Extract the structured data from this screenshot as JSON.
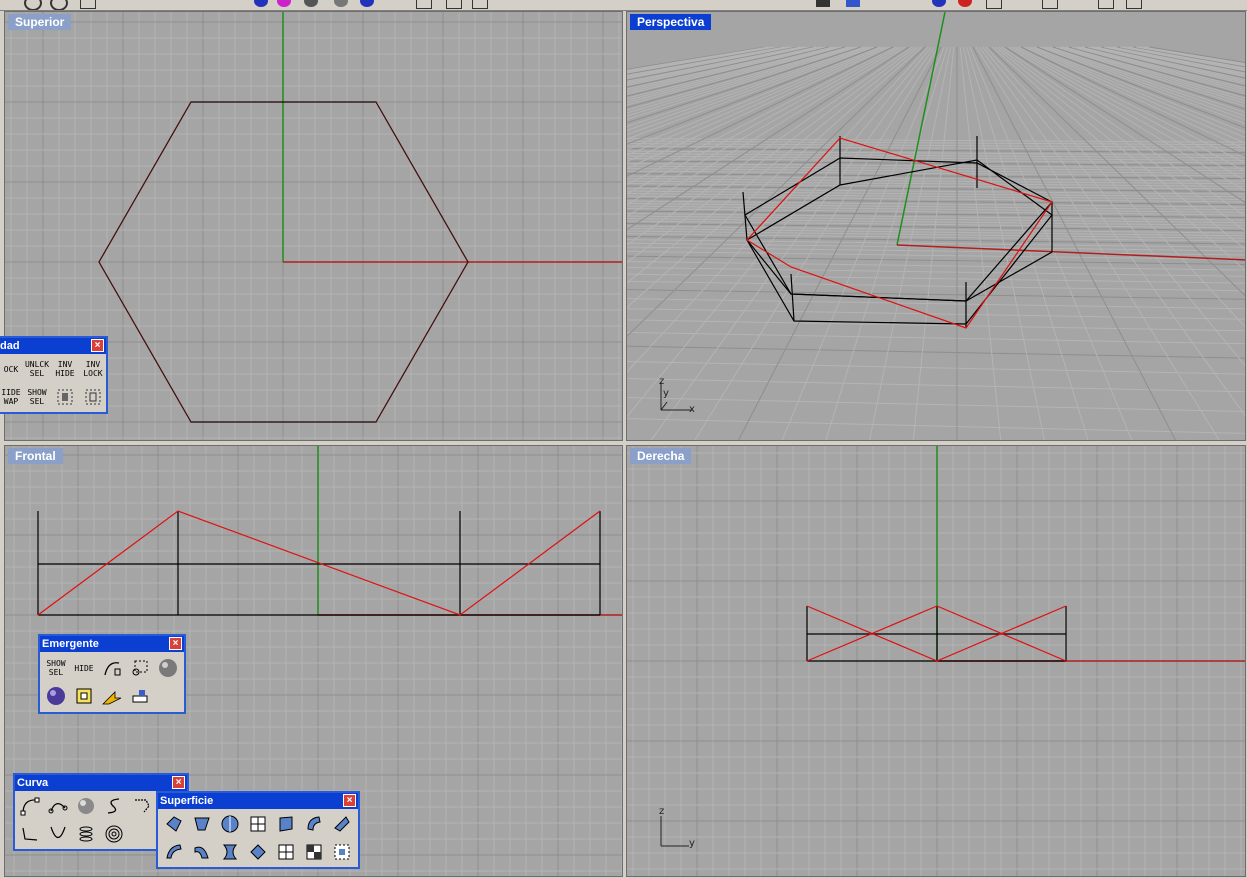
{
  "viewports": {
    "top": {
      "title": "Superior",
      "active": false
    },
    "perspective": {
      "title": "Perspectiva",
      "active": true,
      "axis": {
        "z": "z",
        "y": "y",
        "x": "x"
      }
    },
    "front": {
      "title": "Frontal",
      "active": false
    },
    "right": {
      "title": "Derecha",
      "active": false,
      "axis": {
        "z": "z",
        "y": "y"
      }
    }
  },
  "toolbars": {
    "visibility": {
      "title": "dad",
      "close": "×",
      "buttons": [
        {
          "line1": "OCK",
          "line2": ""
        },
        {
          "line1": "UNLCK",
          "line2": "SEL"
        },
        {
          "line1": "INV",
          "line2": "HIDE"
        },
        {
          "line1": "INV",
          "line2": "LOCK"
        },
        {
          "line1": "IIDE",
          "line2": "WAP"
        },
        {
          "line1": "SHOW",
          "line2": "SEL"
        }
      ]
    },
    "popup": {
      "title": "Emergente",
      "close": "×",
      "buttons": [
        {
          "line1": "SHOW",
          "line2": "SEL"
        },
        {
          "line1": "HIDE",
          "line2": ""
        }
      ]
    },
    "curve": {
      "title": "Curva",
      "close": "×"
    },
    "surface": {
      "title": "Superficie",
      "close": "×"
    }
  },
  "colors": {
    "viewport_bg": "#a5a5a5",
    "grid_minor": "#b4b4b4",
    "grid_major": "#8e8e8e",
    "x_axis": "#b01e1e",
    "y_axis": "#1e8f1e",
    "curve_black": "#000000",
    "curve_red": "#e01010",
    "active_title": "#0a3fd2",
    "inactive_title": "#8aa0c9"
  }
}
